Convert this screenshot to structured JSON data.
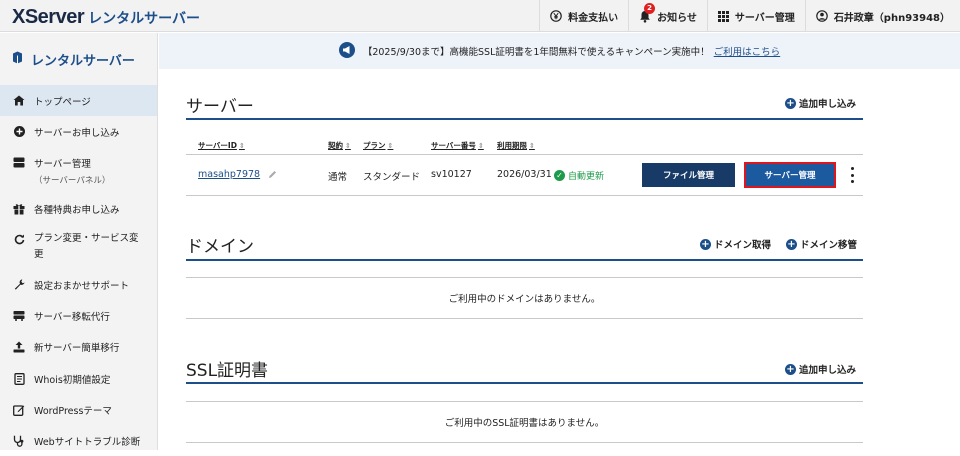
{
  "header": {
    "logo_main": "XServer",
    "logo_sub": "レンタルサーバー",
    "nav": {
      "billing": "料金支払い",
      "notices": "お知らせ",
      "notices_badge": "2",
      "server_mgmt": "サーバー管理",
      "user": "石井政章（phn93948）"
    }
  },
  "sidebar": {
    "title": "レンタルサーバー",
    "items": [
      {
        "label": "トップページ",
        "icon": "home-icon"
      },
      {
        "label": "サーバーお申し込み",
        "icon": "plus-circle-icon"
      },
      {
        "label": "サーバー管理",
        "sub": "（サーバーパネル）",
        "icon": "server-icon"
      },
      {
        "label": "各種特典お申し込み",
        "icon": "gift-icon"
      },
      {
        "label": "プラン変更・サービス変更",
        "icon": "refresh-icon"
      },
      {
        "label": "設定おまかせサポート",
        "icon": "wrench-icon"
      },
      {
        "label": "サーバー移転代行",
        "icon": "truck-icon"
      },
      {
        "label": "新サーバー簡単移行",
        "icon": "upload-icon"
      },
      {
        "label": "Whois初期値設定",
        "icon": "document-icon"
      },
      {
        "label": "WordPressテーマ",
        "icon": "edit-icon"
      },
      {
        "label": "Webサイトトラブル診断",
        "icon": "stethoscope-icon"
      }
    ]
  },
  "banner": {
    "text": "【2025/9/30まで】高機能SSL証明書を1年間無料で使えるキャンペーン実施中！",
    "link": "ご利用はこちら"
  },
  "server_section": {
    "title": "サーバー",
    "add_label": "追加申し込み",
    "columns": {
      "server_id": "サーバーID",
      "contract": "契約",
      "plan": "プラン",
      "server_number": "サーバー番号",
      "expiry": "利用期限"
    },
    "row": {
      "server_id": "masahp7978",
      "contract": "通常",
      "plan": "スタンダード",
      "server_number": "sv10127",
      "expiry": "2026/03/31",
      "renew": "自動更新",
      "file_button": "ファイル管理",
      "server_button": "サーバー管理"
    }
  },
  "domain_section": {
    "title": "ドメイン",
    "acquire_label": "ドメイン取得",
    "transfer_label": "ドメイン移管",
    "empty": "ご利用中のドメインはありません。"
  },
  "ssl_section": {
    "title": "SSL証明書",
    "add_label": "追加申し込み",
    "empty": "ご利用中のSSL証明書はありません。"
  },
  "colors": {
    "brand": "#1c4e8a",
    "button_dark": "#173b66",
    "highlight_border": "#e0161e",
    "success": "#1e9b4a"
  }
}
